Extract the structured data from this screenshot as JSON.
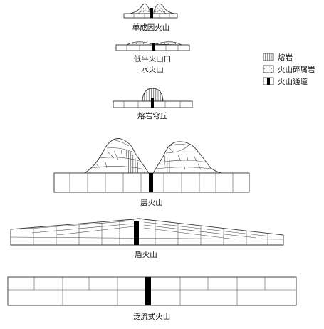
{
  "legend": [
    {
      "id": "lava",
      "label": "熔岩"
    },
    {
      "id": "pyroclastic",
      "label": "火山碎屑岩"
    },
    {
      "id": "conduit",
      "label": "火山通道"
    }
  ],
  "volcano_types": [
    {
      "id": "monogenetic",
      "label": "单成因火山"
    },
    {
      "id": "low_crater",
      "label_line1": "低平火山口",
      "label_line2": "水火山"
    },
    {
      "id": "lava_dome",
      "label": "熔岩穹丘"
    },
    {
      "id": "stratovolcano",
      "label": "层火山"
    },
    {
      "id": "shield",
      "label": "盾火山"
    },
    {
      "id": "flood",
      "label": "泛流式火山"
    }
  ]
}
